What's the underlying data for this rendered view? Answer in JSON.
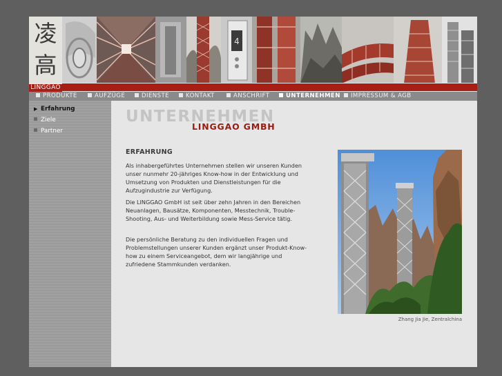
{
  "logo": {
    "char_top": "凌",
    "char_bottom": "高",
    "text": "LINGGAO"
  },
  "nav": {
    "items": [
      {
        "label": "PRODUKTE"
      },
      {
        "label": "AUFZÜGE"
      },
      {
        "label": "DIENSTE"
      },
      {
        "label": "KONTAKT"
      },
      {
        "label": "ANSCHRIFT"
      },
      {
        "label": "UNTERNEHMEN",
        "active": true
      },
      {
        "label": "IMPRESSUM & AGB"
      }
    ]
  },
  "banner": {
    "number_display": "4"
  },
  "sidebar": {
    "items": [
      {
        "label": "Erfahrung",
        "active": true
      },
      {
        "label": "Ziele"
      },
      {
        "label": "Partner"
      }
    ]
  },
  "main": {
    "title_back": "UNTERNEHMEN",
    "title_front": "LINGGAO GMBH",
    "heading": "ERFAHRUNG",
    "paragraphs": [
      "Als inhabergeführtes Unternehmen stellen wir unseren Kunden unser nunmehr 20-jähriges Know-how in der Entwicklung und Umsetzung von Produkten und Dienstleistungen für die Aufzugindustrie zur Verfügung.",
      "Die LINGGAO GmbH ist seit über zehn Jahren in den Bereichen Neuanlagen, Bausätze, Komponenten, Messtechnik, Trouble-Shooting, Aus- und Weiterbildung sowie Mess-Service tätig.",
      "Die persönliche Beratung zu den individuellen Fragen und Problemstellungen unserer Kunden ergänzt unser Produkt-Know-how zu einem Serviceangebot, dem wir langjährige und zufriedene Stammkunden verdanken."
    ],
    "photo_caption": "Zhang Jia Jie, Zentralchina"
  },
  "colors": {
    "brand_red": "#a61e14",
    "page_bg": "#5f5f5f",
    "content_bg": "#e6e6e6",
    "nav_bg": "#8a8a8a"
  }
}
